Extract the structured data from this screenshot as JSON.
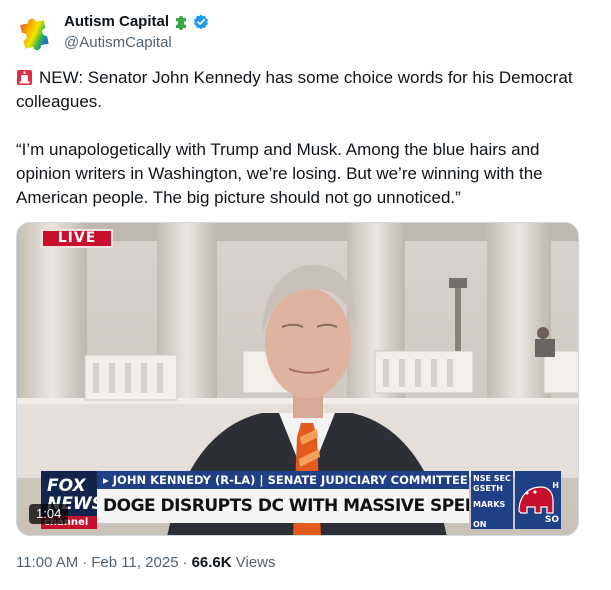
{
  "author": {
    "display_name": "Autism Capital",
    "handle": "@AutismCapital",
    "avatar_icon": "rainbow-puzzle-piece-icon",
    "badge_icons": [
      "green-puzzle-piece-icon",
      "verified-badge-icon"
    ],
    "verified_color": "#1d9bf0"
  },
  "tweet": {
    "lead_icon": "police-siren-emoji-icon",
    "paragraph1": "NEW: Senator John Kennedy has some choice words for his Democrat colleagues.",
    "paragraph2": "“I’m unapologetically with Trump and Musk. Among the blue hairs and opinion writers in Washington, we’re losing. But we’re winning with the American people. The big picture should not go unnoticed.”"
  },
  "video": {
    "live_badge": "LIVE",
    "duration": "1:04",
    "network_line1": "FOX",
    "network_line2": "NEWS",
    "network_channel": "channel",
    "name_strip": "▸ JOHN KENNEDY (R-LA) | SENATE JUDICIARY COMMITTEE",
    "headline": "DOGE DISRUPTS DC WITH MASSIVE SPENDING CUTS",
    "side_ticker": [
      "NSE SEC",
      "GSETH",
      "MARKS",
      "ON"
    ],
    "right_box_tag": "H",
    "right_box_bottom": "SO"
  },
  "meta": {
    "time": "11:00 AM",
    "date": "Feb 11, 2025",
    "views_count": "66.6K",
    "views_label": "Views"
  },
  "colors": {
    "text_primary": "#0f1419",
    "text_secondary": "#536471",
    "fox_red": "#c8102e",
    "fox_navy": "#12244d",
    "fox_blue": "#1f3f86"
  }
}
